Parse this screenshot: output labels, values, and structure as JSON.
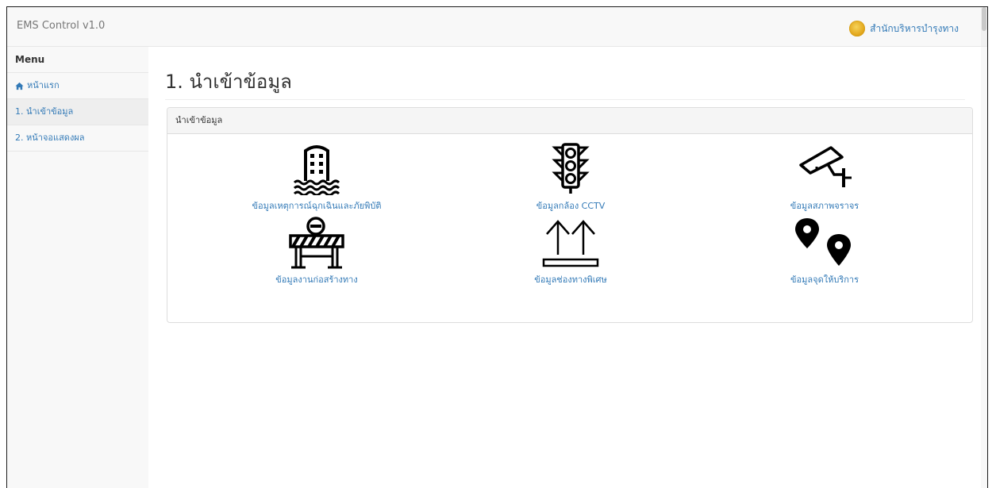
{
  "app": {
    "brand": "EMS Control v1.0",
    "agency": "สำนักบริหารบำรุงทาง"
  },
  "sidebar": {
    "title": "Menu",
    "items": [
      {
        "label": "หน้าแรก",
        "icon": "home-icon"
      },
      {
        "label": "1. นำเข้าข้อมูล",
        "active": true
      },
      {
        "label": "2. หน้าจอแสดงผล"
      }
    ]
  },
  "main": {
    "title": "1. นำเข้าข้อมูล",
    "panel": {
      "heading": "นำเข้าข้อมูล",
      "tiles": [
        {
          "label": "ข้อมูลเหตุการณ์ฉุกเฉินและภัยพิบัติ",
          "icon": "flooded-building-icon"
        },
        {
          "label": "ข้อมูลกล้อง CCTV",
          "icon": "traffic-light-icon"
        },
        {
          "label": "ข้อมูลสภาพจราจร",
          "icon": "cctv-camera-icon"
        },
        {
          "label": "ข้อมูลงานก่อสร้างทาง",
          "icon": "road-barrier-icon"
        },
        {
          "label": "ข้อมูลช่องทางพิเศษ",
          "icon": "up-arrows-lane-icon"
        },
        {
          "label": "ข้อมูลจุดให้บริการ",
          "icon": "map-pins-icon"
        }
      ]
    }
  },
  "colors": {
    "link": "#337ab7",
    "navbar_bg": "#f8f8f8",
    "border": "#dddddd"
  }
}
